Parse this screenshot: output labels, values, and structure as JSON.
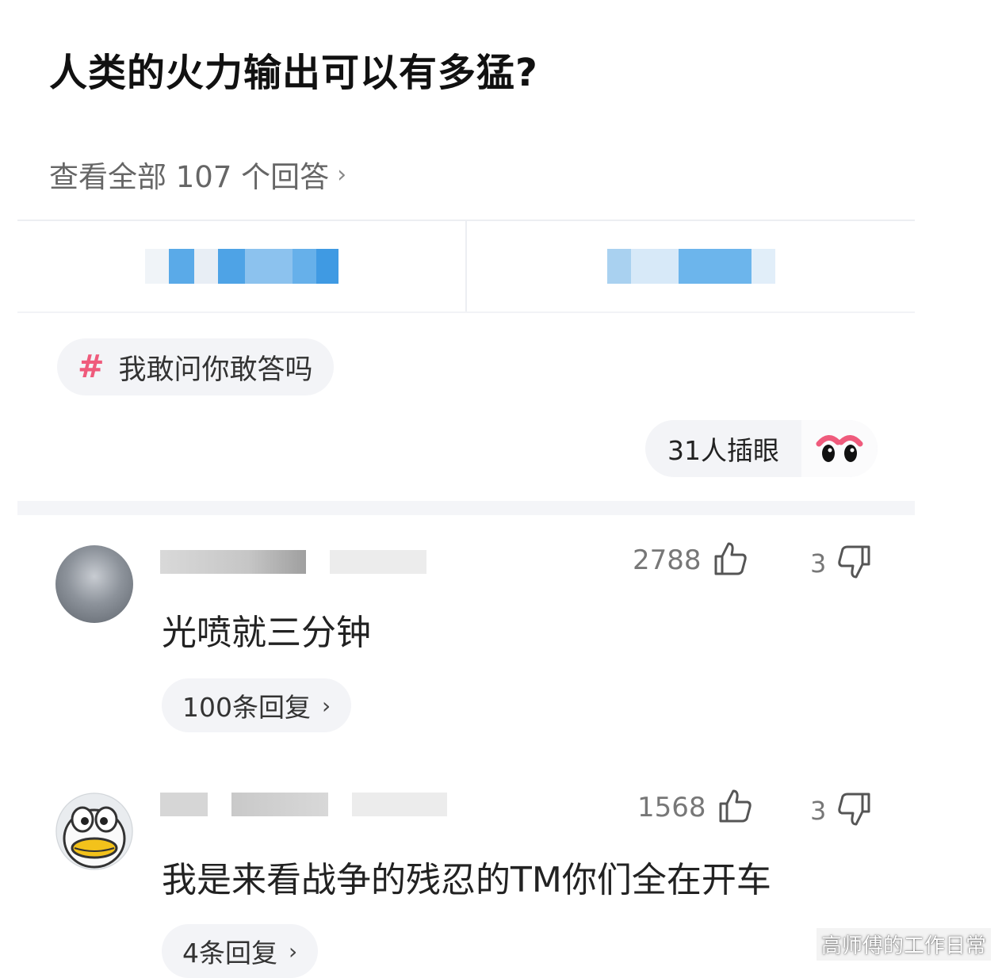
{
  "question": {
    "title": "人类的火力输出可以有多猛?",
    "view_all_label": "查看全部 107 个回答"
  },
  "topic": {
    "label": "我敢问你敢答吗"
  },
  "watch": {
    "label": "31人插眼"
  },
  "comments": [
    {
      "text": "光喷就三分钟",
      "likes": "2788",
      "dislikes": "3",
      "replies_label": "100条回复"
    },
    {
      "text": "我是来看战争的残忍的TM你们全在开车",
      "likes": "1568",
      "dislikes": "3",
      "replies_label": "4条回复"
    }
  ],
  "watermark": {
    "text": "高师傅的工作日常"
  },
  "colors": {
    "accent_pink": "#ef5b7c",
    "link_blue": "#4ea3e6",
    "muted_text": "#777777"
  }
}
